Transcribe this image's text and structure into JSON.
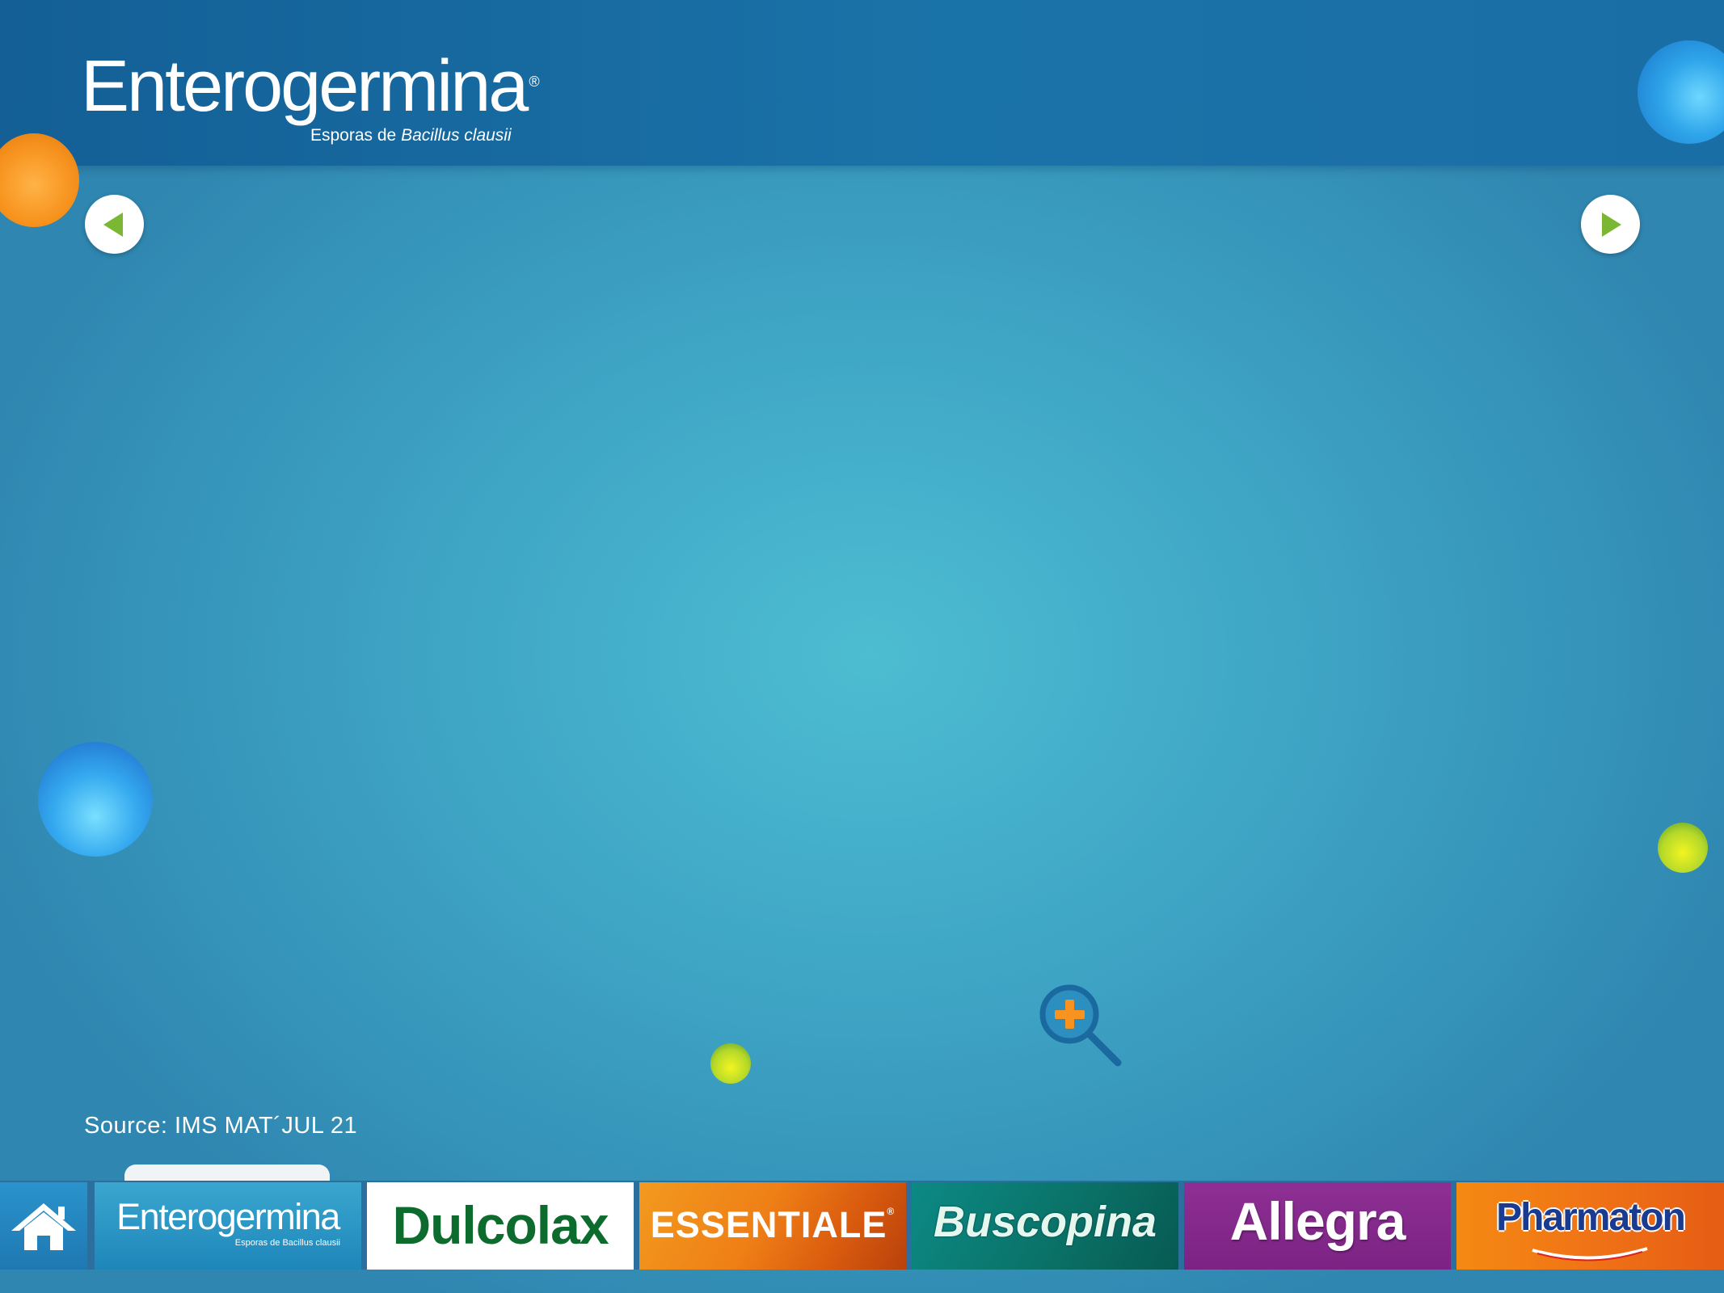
{
  "header": {
    "logo_main": "Enterogermina",
    "logo_reg": "®",
    "logo_sub_prefix": "Esporas de ",
    "logo_sub_italic": "Bacillus clausii"
  },
  "navigation": {
    "prev_icon": "triangle-left-icon",
    "next_icon": "triangle-right-icon"
  },
  "zoom": {
    "icon": "magnifier-plus-icon"
  },
  "footer": {
    "source": "Source: IMS MAT´JUL 21"
  },
  "bottom_bar": {
    "home_icon": "house-icon",
    "brands": [
      {
        "label": "Enterogermina",
        "sub": "Esporas de Bacillus clausii"
      },
      {
        "label": "Dulcolax"
      },
      {
        "label": "ESSENTIALE",
        "reg": "®"
      },
      {
        "label": "Buscopina"
      },
      {
        "label": "Allegra"
      },
      {
        "label": "Pharmaton"
      }
    ]
  },
  "colors": {
    "header": "#135f96",
    "background_center": "#4dbdd1",
    "background_edge": "#2f86b0",
    "arrow_green": "#7ab833",
    "zoom_blue": "#1a6aa0",
    "zoom_orange": "#f7931e"
  }
}
